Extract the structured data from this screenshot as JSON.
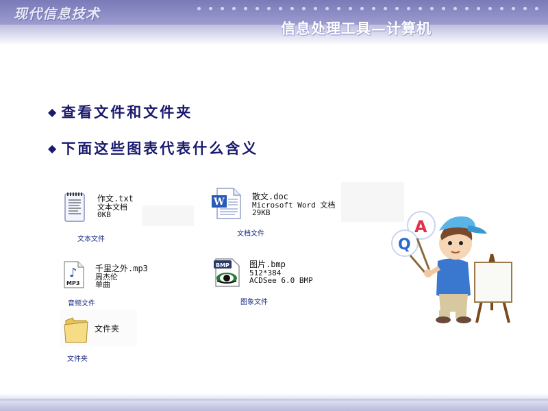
{
  "header": {
    "brand": "现代信息技术",
    "subtitle": "信息处理工具—计算机"
  },
  "bullets": [
    {
      "marker": "◆",
      "text": "查看文件和文件夹"
    },
    {
      "marker": "◆",
      "text": "下面这些图表代表什么含义"
    }
  ],
  "files": {
    "txt": {
      "name": "作文.txt",
      "line2": "文本文档",
      "line3": "0KB",
      "caption": "文本文件",
      "icon": "text-document-icon"
    },
    "doc": {
      "name": "散文.doc",
      "line2": "Microsoft Word 文档",
      "line3": "29KB",
      "caption": "文档文件",
      "icon": "word-document-icon"
    },
    "mp3": {
      "name": "千里之外.mp3",
      "line2": "周杰伦",
      "line3": "单曲",
      "caption": "音频文件",
      "icon": "audio-file-icon"
    },
    "bmp": {
      "name": "图片.bmp",
      "line2": "512*384",
      "line3": "ACDSee 6.0 BMP",
      "caption": "图象文件",
      "icon": "image-file-icon",
      "badge": "BMP"
    },
    "folder": {
      "name": "文件夹",
      "caption": "文件夹",
      "icon": "folder-icon"
    }
  },
  "illustration": {
    "sign_top": "A",
    "sign_bottom": "Q",
    "icon": "boy-with-easel-illustration"
  }
}
